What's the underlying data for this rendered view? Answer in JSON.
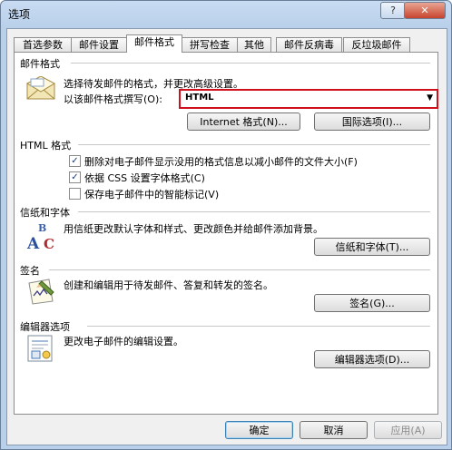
{
  "dialog": {
    "title": "选项",
    "help": "?",
    "close": "✕"
  },
  "tabs": [
    {
      "label": "首选参数"
    },
    {
      "label": "邮件设置"
    },
    {
      "label": "邮件格式"
    },
    {
      "label": "拼写检查"
    },
    {
      "label": "其他"
    },
    {
      "label": "邮件反病毒"
    },
    {
      "label": "反垃圾邮件"
    }
  ],
  "mail_format": {
    "header": "邮件格式",
    "desc": "选择待发邮件的格式，并更改高级设置。",
    "compose_label": "以该邮件格式撰写(O):",
    "compose_value": "HTML",
    "internet_button": "Internet 格式(N)...",
    "intl_button": "国际选项(I)..."
  },
  "html_format": {
    "header": "HTML 格式",
    "options": [
      {
        "label": "删除对电子邮件显示没用的格式信息以减小邮件的文件大小(F)",
        "checked": true
      },
      {
        "label": "依据 CSS 设置字体格式(C)",
        "checked": true
      },
      {
        "label": "保存电子邮件中的智能标记(V)",
        "checked": false
      }
    ]
  },
  "stationery": {
    "header": "信纸和字体",
    "desc": "用信纸更改默认字体和样式、更改颜色并给邮件添加背景。",
    "button": "信纸和字体(T)...",
    "icon_letters": "ABC"
  },
  "signatures": {
    "header": "签名",
    "desc": "创建和编辑用于待发邮件、答复和转发的签名。",
    "button": "签名(G)..."
  },
  "editor": {
    "header": "编辑器选项",
    "desc": "更改电子邮件的编辑设置。",
    "button": "编辑器选项(D)..."
  },
  "footer": {
    "ok": "确定",
    "cancel": "取消",
    "apply": "应用(A)"
  }
}
